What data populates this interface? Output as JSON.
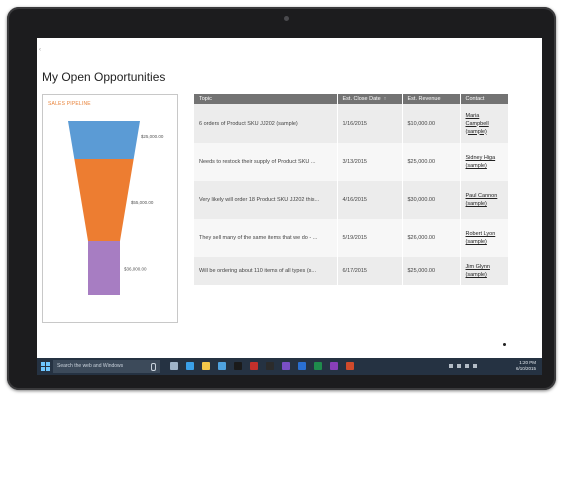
{
  "page": {
    "title": "My Open Opportunities",
    "corner_mark": "‹"
  },
  "funnel": {
    "title": "SALES PIPELINE",
    "title_color": "#e8833a",
    "chart_data": {
      "type": "funnel",
      "title": "SALES PIPELINE",
      "stages": [
        {
          "value": 25000,
          "label": "$25,000.00",
          "color": "#5b9bd5"
        },
        {
          "value": 55000,
          "label": "$55,000.00",
          "color": "#ed7d31"
        },
        {
          "value": 36000,
          "label": "$36,000.00",
          "color": "#a77dc2"
        }
      ]
    }
  },
  "table": {
    "columns": [
      "Topic",
      "Est. Close Date",
      "Est. Revenue",
      "Contact"
    ],
    "sort_indicator": "↑",
    "rows": [
      {
        "topic": "6 orders of Product SKU JJ202 (sample)",
        "close_date": "1/16/2015",
        "revenue": "$10,000.00",
        "contact_name": "Maria Campbell",
        "contact_suffix": "(sample)"
      },
      {
        "topic": "Needs to restock their supply of Product SKU ...",
        "close_date": "3/13/2015",
        "revenue": "$25,000.00",
        "contact_name": "Sidney Higa",
        "contact_suffix": "(sample)"
      },
      {
        "topic": "Very likely will order 18 Product SKU JJ202 this...",
        "close_date": "4/16/2015",
        "revenue": "$30,000.00",
        "contact_name": "Paul Cannon",
        "contact_suffix": "(sample)"
      },
      {
        "topic": "They sell many of the same items that we do - ...",
        "close_date": "5/19/2015",
        "revenue": "$26,000.00",
        "contact_name": "Robert Lyon",
        "contact_suffix": "(sample)"
      },
      {
        "topic": "Will be ordering about 110 items of all types (s...",
        "close_date": "6/17/2015",
        "revenue": "$25,000.00",
        "contact_name": "Jim Glynn",
        "contact_suffix": "(sample)"
      }
    ]
  },
  "taskbar": {
    "search_placeholder": "Search the web and Windows",
    "pinned_icons": [
      {
        "name": "task-view-icon",
        "color": "#9fb3c8"
      },
      {
        "name": "edge-icon",
        "color": "#3aa0e8"
      },
      {
        "name": "file-explorer-icon",
        "color": "#f3c74a"
      },
      {
        "name": "store-icon",
        "color": "#4fa3e0"
      },
      {
        "name": "app-black-icon",
        "color": "#1a1a1a"
      },
      {
        "name": "acrobat-icon",
        "color": "#c4302b"
      },
      {
        "name": "app-terminal-icon",
        "color": "#2b2b2b"
      },
      {
        "name": "visual-studio-icon",
        "color": "#7a4fc6"
      },
      {
        "name": "outlook-icon",
        "color": "#2a6fd1"
      },
      {
        "name": "excel-icon",
        "color": "#1f8b4c"
      },
      {
        "name": "onenote-icon",
        "color": "#8a3fb8"
      },
      {
        "name": "powerpoint-icon",
        "color": "#d04a2b"
      }
    ],
    "clock_time": "1:20 PM",
    "clock_date": "6/10/2015"
  }
}
